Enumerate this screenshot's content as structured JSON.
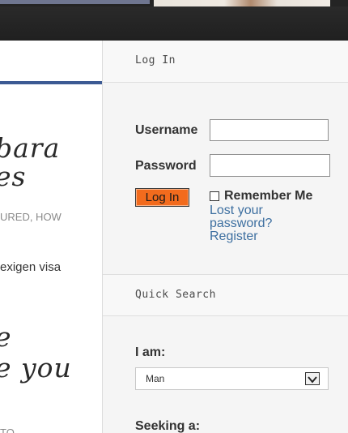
{
  "left": {
    "title_line1": "bara",
    "title_line2": "es",
    "meta": "URED, HOW",
    "excerpt": "exigen visa",
    "title2_line1": "e",
    "title2_line2": "e you",
    "footer_fragment": "TO"
  },
  "login": {
    "heading": "Log In",
    "username_label": "Username",
    "password_label": "Password",
    "login_button": "Log In",
    "remember_label": "Remember Me",
    "lost_password_link_line1": "Lost your",
    "lost_password_link_line2": "password?",
    "register_link": "Register",
    "remember_checked": false
  },
  "search": {
    "heading": "Quick Search",
    "i_am_label": "I am:",
    "i_am_value": "Man",
    "seeking_label": "Seeking a:"
  },
  "colors": {
    "accent_button": "#f26b1d",
    "link": "#3d6fa0",
    "rule_blue": "#3c5a93"
  }
}
